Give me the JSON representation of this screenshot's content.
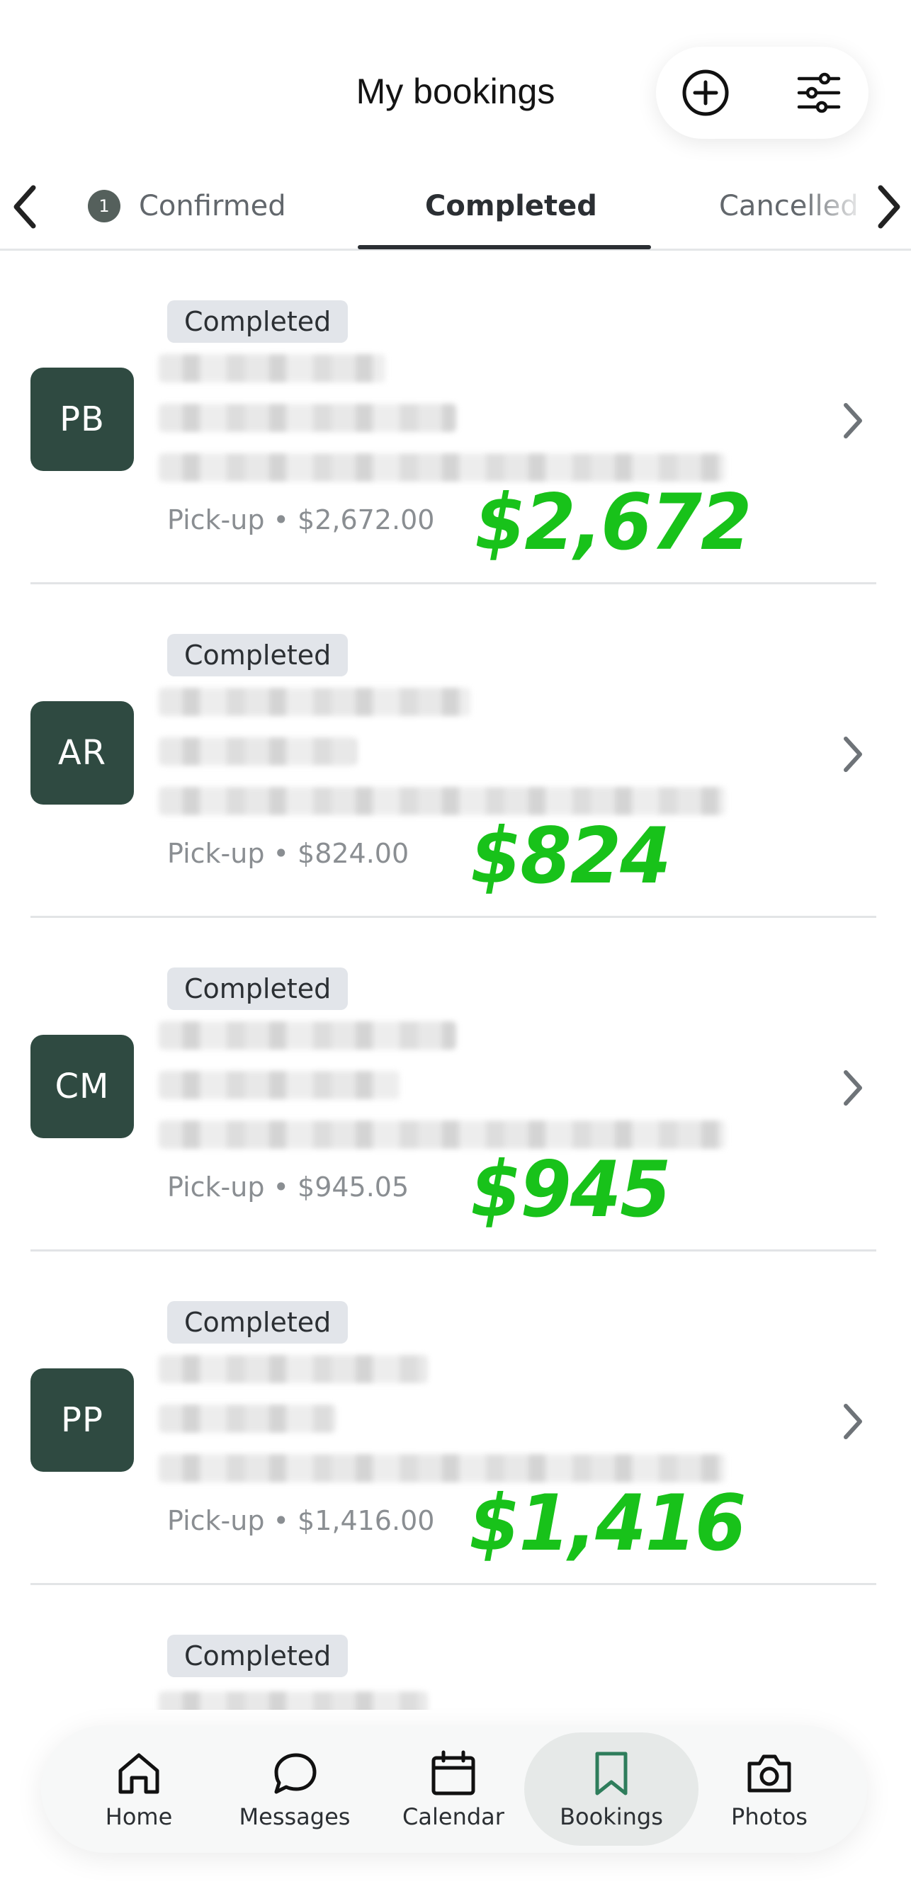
{
  "header": {
    "title": "My bookings",
    "add_icon": "plus-circle-icon",
    "filter_icon": "sliders-icon"
  },
  "tabs": {
    "items": [
      {
        "label": "Confirmed",
        "count": "1"
      },
      {
        "label": "Completed"
      },
      {
        "label": "Cancelled"
      }
    ],
    "active": "Completed"
  },
  "bookings": [
    {
      "initials": "PB",
      "status": "Completed",
      "pickup": "Pick-up • $2,672.00",
      "annotation": "$2,672"
    },
    {
      "initials": "AR",
      "status": "Completed",
      "pickup": "Pick-up • $824.00",
      "annotation": "$824"
    },
    {
      "initials": "CM",
      "status": "Completed",
      "pickup": "Pick-up • $945.05",
      "annotation": "$945"
    },
    {
      "initials": "PP",
      "status": "Completed",
      "pickup": "Pick-up • $1,416.00",
      "annotation": "$1,416"
    },
    {
      "status": "Completed"
    }
  ],
  "colors": {
    "avatar": "#2f4a41",
    "annotation": "#18c21a",
    "active_nav": "#2e7d5b"
  },
  "nav": {
    "items": [
      {
        "label": "Home",
        "icon": "home-icon"
      },
      {
        "label": "Messages",
        "icon": "message-bubble-icon"
      },
      {
        "label": "Calendar",
        "icon": "calendar-icon"
      },
      {
        "label": "Bookings",
        "icon": "bookmark-icon"
      },
      {
        "label": "Photos",
        "icon": "camera-icon"
      }
    ],
    "active": "Bookings"
  }
}
